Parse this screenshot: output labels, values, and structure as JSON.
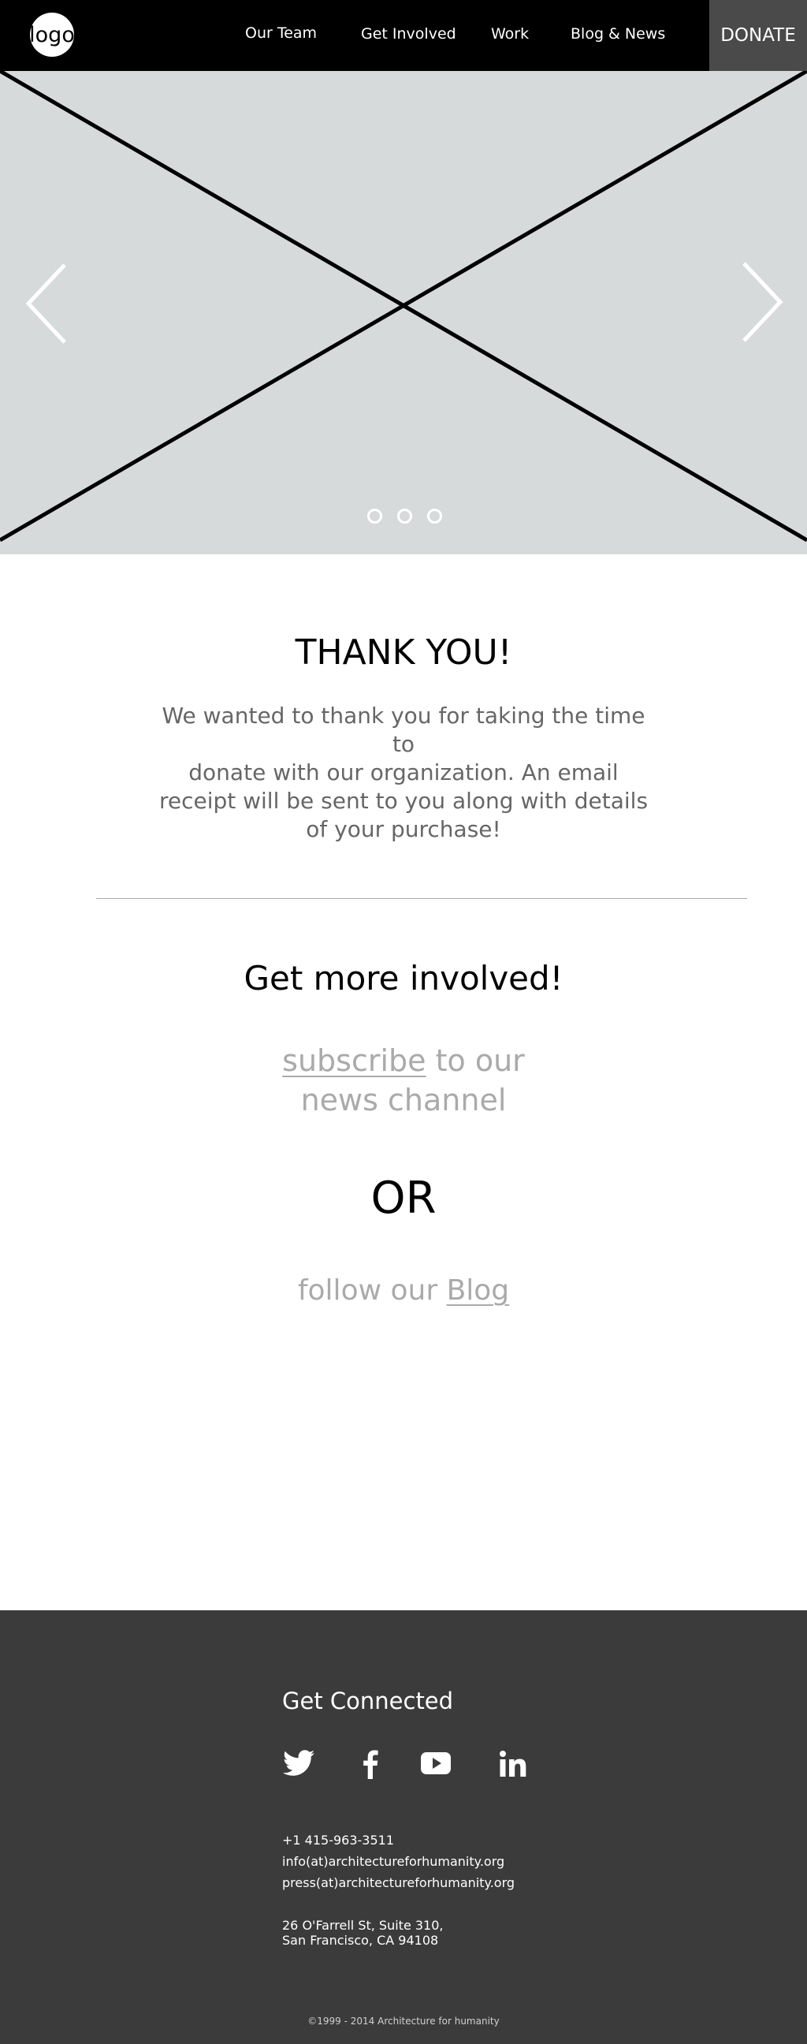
{
  "header": {
    "logo": "logo",
    "nav": [
      "Our Team",
      "Get Involved",
      "Work",
      "Blog & News"
    ],
    "donate": "DONATE"
  },
  "hero": {
    "slide_count": 3,
    "prev_icon": "chevron-left-icon",
    "next_icon": "chevron-right-icon",
    "background": "#d7dadb"
  },
  "thanks": {
    "title": "THANK YOU!",
    "lines": [
      "We wanted to thank you for taking the time to",
      "donate with our organization. An email",
      "receipt will be sent to you along with details",
      "of your purchase!"
    ]
  },
  "involved": {
    "title": "Get more involved!",
    "subscribe_link": "subscribe",
    "subscribe_rest": " to our",
    "subscribe_line2": "news channel",
    "or": "OR",
    "follow_text": "follow our ",
    "blog_link": "Blog"
  },
  "footer": {
    "title": "Get Connected",
    "social": [
      "twitter-icon",
      "facebook-icon",
      "youtube-icon",
      "linkedin-icon"
    ],
    "phone": "+1 415-963-3511",
    "email_info": "info(at)architectureforhumanity.org",
    "email_press": "press(at)architectureforhumanity.org",
    "address_line1": "26 O'Farrell St, Suite 310,",
    "address_line2": "San Francisco, CA 94108",
    "copyright": "©1999 - 2014 Architecture for humanity",
    "background": "#3c3b3c"
  }
}
